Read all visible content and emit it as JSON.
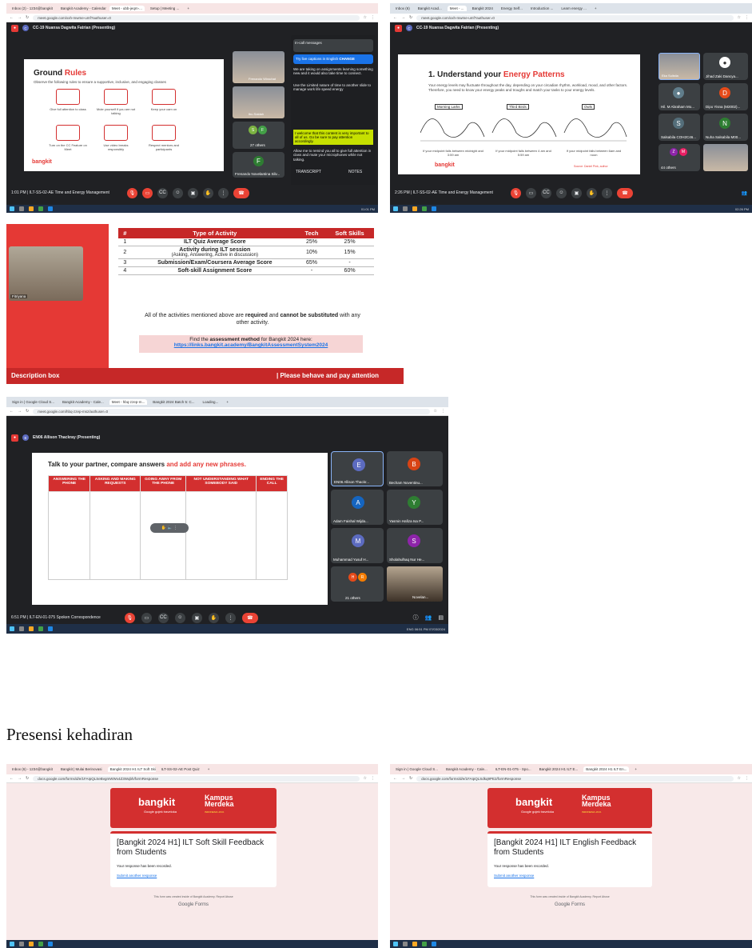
{
  "screens": {
    "s1": {
      "tabs": [
        "Inbox (2) - 1234@bangkit",
        "Bangkit Academy - Calendar",
        "Meet - ubb-jeqm-...",
        "Setup | Meeting ...",
        "+"
      ],
      "url": "meet.google.com/xxh-mwme-umf?authuser=0",
      "presenting": "CC-19 Nuansa Dagwita Fatrian (Presenting)",
      "slide_title_a": "Ground",
      "slide_title_b": "Rules",
      "slide_subtitle": "Observe the following rules to ensure a supportive, inclusive, and engaging classes",
      "rules": [
        "Give full attention to class",
        "Mute yourself if you are not talking",
        "Keep your cam on",
        "Turn on the CC Feature on Meet",
        "Use video breaks responsibly",
        "Respect mentors and participants"
      ],
      "brand": "bangkit",
      "tile_names": [
        "Frenando Wirachat",
        "Ibu Saidah",
        "27 others",
        "Frenando Novelantina Silv..."
      ],
      "others_label": "27 others",
      "f_initial": "F",
      "chat_header": "In-call messages",
      "chat_note": "Try live captions in English",
      "chat_change": "CHANGE",
      "chat_msgs": [
        "We are taking on assignments learning something new and it would also take time to connect.",
        "Use the Limited nature of time to another slide to manage work life speed energy",
        "I welcome that this content is very important to all of us. Go be sure to pay attention accordingly.",
        "Allow me to remind you all to give full attention in class and mute your microphones while not talking."
      ],
      "transcript": "TRANSCRIPT",
      "notes": "NOTES",
      "footer_info": "1:01 PM | ILT-SS-02-AE Time and Energy Management",
      "clock": "01:01 PM"
    },
    "s2": {
      "tabs": [
        "Inbox (6)",
        "Bangkit Acad...",
        "Meet - ...",
        "Bangkit 2024",
        "Energy Self...",
        "Introduction ...",
        "Learn energy ...",
        "+"
      ],
      "url": "meet.google.com/xxh-mwme-umf?authuser=0",
      "presenting": "CC-19 Nuansa Dagwita Fatrian (Presenting)",
      "slide_title_a": "1. Understand your",
      "slide_title_b": "Energy Patterns",
      "slide_body": "Your energy levels may fluctuate throughout the day, depending on your circadian rhythm, workload, mood, and other factors. Therefore, you need to know your energy peaks and troughs and match your tasks to your energy levels.",
      "chart_labels": [
        "Morning Larks",
        "Third Birds",
        "Owls"
      ],
      "chart_captions": [
        "If your midpoint falls between midnight and 3:59 am",
        "If your midpoint falls between 4 am and 5:59 am",
        "If your midpoint falls between 6am and noon"
      ],
      "source": "Source: Daniel Pink, author",
      "brand": "bangkit",
      "tile_names": [
        "Eka Sulistia",
        "Jihad Zaki Dancya...",
        "Hil. M Abraham Mo...",
        "Dipo Yisna (M2002)...",
        "Salsabila COH2C46...",
        "Nuha Salsabila M00...",
        "44 others"
      ],
      "initials": [
        "S",
        "N",
        "D",
        "Z",
        "M"
      ],
      "footer_info": "2:26 PM | ILT-SS-02-AE Time and Energy Management",
      "clock": "02:26 PM"
    },
    "s3": {
      "presenter": "Fitriyana",
      "headers": [
        "#",
        "Type of Activity",
        "Tech",
        "Soft Skills"
      ],
      "rows": [
        {
          "n": "1",
          "name": "ILT Quiz Average Score",
          "sub": "",
          "tech": "25%",
          "soft": "25%"
        },
        {
          "n": "2",
          "name": "Activity during ILT session",
          "sub": "(Asking, Answering, Active in discussion)",
          "tech": "10%",
          "soft": "15%"
        },
        {
          "n": "3",
          "name": "Submission/Exam/Coursera Average Score",
          "sub": "",
          "tech": "65%",
          "soft": "-"
        },
        {
          "n": "4",
          "name": "Soft-skill Assignment Score",
          "sub": "",
          "tech": "-",
          "soft": "60%"
        }
      ],
      "note_a": "All of the activities mentioned above are",
      "note_b": "required",
      "note_c": "and",
      "note_d": "cannot be substituted",
      "note_e": "with any other activity.",
      "link_a": "Find the",
      "link_b": "assessment method",
      "link_c": "for Bangkit 2024 here:",
      "link_url": "https://links.bangkit.academy/BangkitAssessmentSystem2024",
      "footer_left": "Description box",
      "footer_right": "| Please behave and pay attention"
    },
    "s4": {
      "tabs": [
        "Sign in | Google Cloud S...",
        "Bangkit Academy - Cale...",
        "Meet - hbq-zzep-m...",
        "Bangkit 2024 Batch 5: C...",
        "Loading...",
        "+"
      ],
      "url": "meet.google.com/hbq-zzep-msz/authuser=0",
      "presenting": "EN06 Allison Thackray (Presenting)",
      "slide_title_a": "Talk to your partner, compare answers",
      "slide_title_b": "and add any new phrases.",
      "columns": [
        "ANSWERING THE PHONE",
        "ASKING AND MAKING REQUESTS",
        "GOING AWAY FROM THE PHONE",
        "NOT UNDERSTANDING WHAT SOMEBODY SAID",
        "ENDING THE CALL"
      ],
      "tiles": [
        {
          "initial": "E",
          "name": "EN06 Allison Thackr...",
          "color": "#5c6bc0"
        },
        {
          "initial": "B",
          "name": "Becham Noventinu...",
          "color": "#d84315"
        },
        {
          "initial": "A",
          "name": "Adam Faishal Wijda...",
          "color": "#1565c0"
        },
        {
          "initial": "Y",
          "name": "Yasmin Hafiza Isa P...",
          "color": "#2e7d32"
        },
        {
          "initial": "M",
          "name": "Muhammad Yusuf H...",
          "color": "#5c6bc0"
        },
        {
          "initial": "S",
          "name": "Sholahulhaq Nur He...",
          "color": "#8e24aa"
        }
      ],
      "others": "21 others",
      "others_initials": [
        "H",
        "R"
      ],
      "novelantina": "Novelan...",
      "footer_info": "6:51 PM | ILT-EN-01-075 Spoken Correspondence",
      "clock": "06:51 PM",
      "date": "07/03/2024",
      "lang": "ENG"
    },
    "heading": "Presensi kehadiran",
    "f1": {
      "tabs": [
        "Inbox (6) - 1234@bangkit",
        "Bangkit | Mulai Berinovasi",
        "Bangkit 2024 H1 ILT Soft Skill",
        "ILT-SS-02-AE Post Quiz",
        "+"
      ],
      "url": "docs.google.com/forms/d/e/1FAIpQLSeBvgmWWx4Z3Wqbh/formResponse",
      "brand": "bangkit",
      "brand_sub": "Google gojek traveloka",
      "kampus_a": "Kampus",
      "kampus_b": "Merdeka",
      "kampus_c": "INDONESIA JAYA",
      "title": "[Bangkit 2024 H1] ILT Soft Skill Feedback from Students",
      "recorded": "Your response has been recorded.",
      "another": "Submit another response",
      "footer_note": "This form was created inside of Bangkit Academy. Report Abuse",
      "google_forms": "Google Forms"
    },
    "f2": {
      "tabs": [
        "Sign in | Google Cloud S...",
        "Bangkit Academy - Cale...",
        "ILT-EN-01-075 - Spo...",
        "Bangkit 2024 H1 ILT E...",
        "Bangkit 2024 H1 ILT En...",
        "+"
      ],
      "url": "docs.google.com/forms/d/e/1FAIpQLSdkq9PE2/formResponse",
      "brand": "bangkit",
      "brand_sub": "Google gojek traveloka",
      "kampus_a": "Kampus",
      "kampus_b": "Merdeka",
      "kampus_c": "INDONESIA JAYA",
      "title": "[Bangkit 2024 H1] ILT English Feedback from Students",
      "recorded": "Your response has been recorded.",
      "another": "Submit another response",
      "footer_note": "This form was created inside of Bangkit Academy. Report Abuse",
      "google_forms": "Google Forms"
    }
  },
  "colors": {
    "bangkit_red": "#d32f2f",
    "meet_dark": "#202124",
    "tile": "#3c4043",
    "taskbar": "#1f2f47"
  },
  "icons": [
    "search-icon",
    "star-icon",
    "menu-icon",
    "mic-icon",
    "camera-icon",
    "captions-icon",
    "present-icon",
    "raise-hand-icon",
    "more-icon",
    "end-call-icon",
    "info-icon",
    "people-icon",
    "chat-icon",
    "windows-icon"
  ]
}
